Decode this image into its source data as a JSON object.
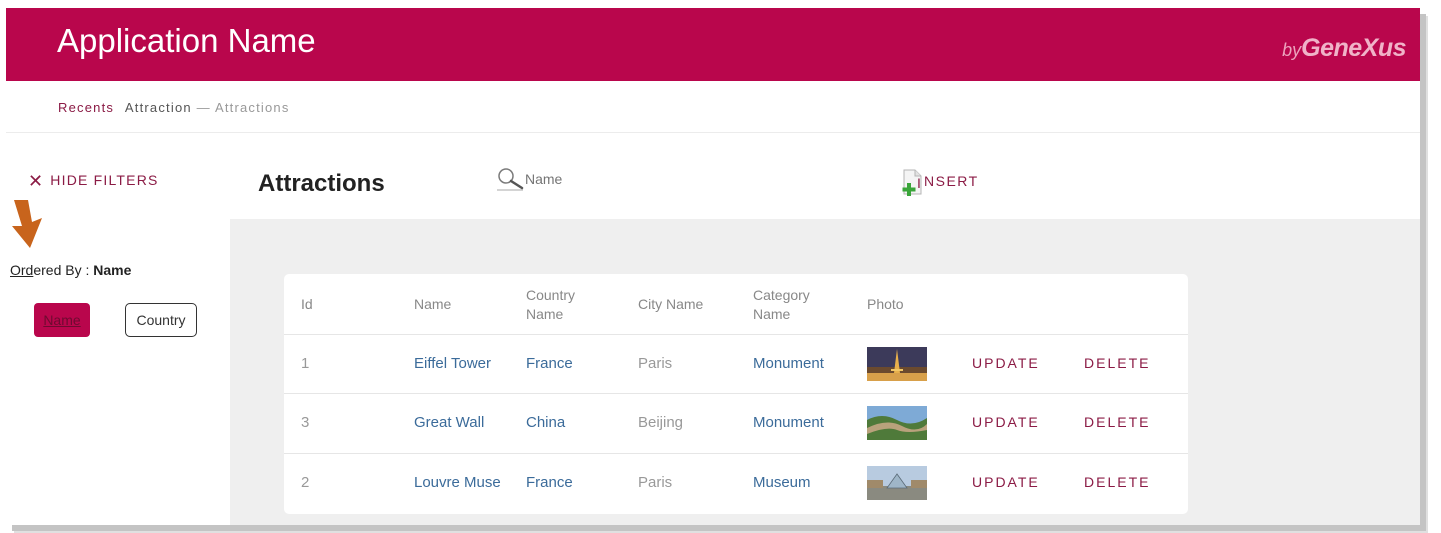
{
  "app": {
    "title": "Application Name",
    "brand_by": "by",
    "brand_name": "GeneXus"
  },
  "breadcrumb": {
    "recents": "Recents",
    "current": "Attraction",
    "separator": "—",
    "sub": "Attractions"
  },
  "filters": {
    "hide_label": "HIDE FILTERS",
    "ordered_prefix": "Ord",
    "ordered_rest": "ered By : ",
    "ordered_value": "Name",
    "order_buttons": [
      {
        "label": "Name",
        "selected": true
      },
      {
        "label": "Country",
        "selected": false
      }
    ]
  },
  "page": {
    "title": "Attractions"
  },
  "search": {
    "placeholder": "Name",
    "value": ""
  },
  "toolbar": {
    "insert_label": "NSERT",
    "insert_first_letter": "I"
  },
  "grid": {
    "headers": {
      "id": "Id",
      "name": "Name",
      "country_name": "Country Name",
      "city_name": "City Name",
      "category_name": "Category Name",
      "photo": "Photo"
    },
    "rows": [
      {
        "id": "1",
        "name": "Eiffel Tower",
        "country": "France",
        "city": "Paris",
        "category": "Monument",
        "photo": "eiffel-tower-photo",
        "update": "UPDATE",
        "delete": "DELETE"
      },
      {
        "id": "3",
        "name": "Great Wall",
        "country": "China",
        "city": "Beijing",
        "category": "Monument",
        "photo": "great-wall-photo",
        "update": "UPDATE",
        "delete": "DELETE"
      },
      {
        "id": "2",
        "name": "Louvre Muse",
        "country": "France",
        "city": "Paris",
        "category": "Museum",
        "photo": "louvre-photo",
        "update": "UPDATE",
        "delete": "DELETE"
      }
    ]
  },
  "colors": {
    "brand": "#b9064c",
    "action": "#8b1b45",
    "link": "#3b6b9a",
    "annotation_arrow": "#c8641c"
  }
}
